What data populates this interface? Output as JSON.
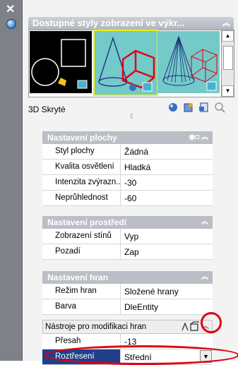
{
  "palette": {
    "title": "Dostupné styly zobrazení ve výkr...",
    "selected_style": "3D Skryté",
    "thumbnails": [
      "2D wireframe",
      "3D hidden",
      "3D wireframe"
    ]
  },
  "tools": [
    "create-style-icon",
    "apply-style-icon",
    "export-icon",
    "purge-icon"
  ],
  "sections": [
    {
      "title": "Nastavení plochy",
      "rows": [
        {
          "label": "Styl plochy",
          "value": "Žádná"
        },
        {
          "label": "Kvalita osvětlení",
          "value": "Hladká"
        },
        {
          "label": "Intenzita zvýrazn...",
          "value": "-30"
        },
        {
          "label": "Neprůhlednost",
          "value": "-60"
        }
      ]
    },
    {
      "title": "Nastavení prostředí",
      "rows": [
        {
          "label": "Zobrazení stínů",
          "value": "Vyp"
        },
        {
          "label": "Pozadí",
          "value": "Zap"
        }
      ]
    },
    {
      "title": "Nastavení hran",
      "rows": [
        {
          "label": "Režim hran",
          "value": "Složené hrany"
        },
        {
          "label": "Barva",
          "value": "DleEntity"
        }
      ]
    }
  ],
  "tooltip": {
    "text": "Nástroje pro modifikaci hran"
  },
  "edge_rows": [
    {
      "label": "Přesah",
      "value": "-13"
    },
    {
      "label": "Roztřesení",
      "value": "Střední"
    }
  ]
}
